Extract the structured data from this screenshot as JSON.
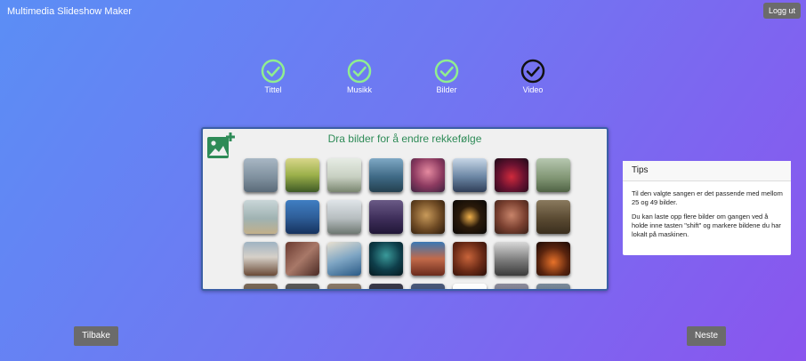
{
  "app": {
    "title": "Multimedia Slideshow Maker",
    "logout_label": "Logg ut"
  },
  "steps": [
    {
      "label": "Tittel",
      "completed": true,
      "current": false
    },
    {
      "label": "Musikk",
      "completed": true,
      "current": false
    },
    {
      "label": "Bilder",
      "completed": true,
      "current": false
    },
    {
      "label": "Video",
      "completed": false,
      "current": true
    }
  ],
  "editor": {
    "header": "Dra bilder for å endre rekkefølge",
    "add_icon": "add-image-icon",
    "accent_color": "#2e8b57"
  },
  "tips": {
    "title": "Tips",
    "paragraphs": [
      "Til den valgte sangen er det passende med mellom 25 og 49 bilder.",
      "Du kan laste opp flere bilder om gangen ved å holde inne tasten \"shift\" og markere bildene du har lokalt på maskinen."
    ]
  },
  "nav": {
    "back_label": "Tilbake",
    "next_label": "Neste"
  },
  "colors": {
    "completed_step": "#90ee90",
    "current_step": "#111111",
    "button_bg": "#6b6b6b",
    "editor_border": "#3b5fa6"
  }
}
